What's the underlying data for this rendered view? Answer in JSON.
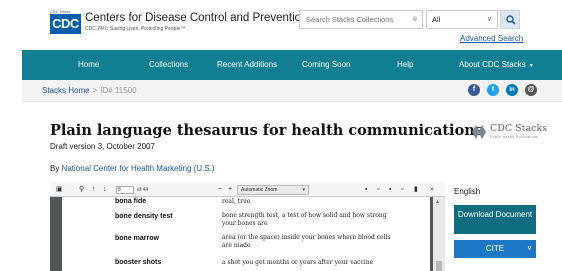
{
  "header": {
    "logo_tag": "CDC Home",
    "logo_text": "CDC",
    "org_name": "Centers for Disease Control and Prevention",
    "tagline": "CDC 24/7: Saving Lives, Protecting People™",
    "search_placeholder": "Search Stacks Collections",
    "scope_value": "All",
    "advanced_search": "Advanced Search"
  },
  "nav": {
    "items": [
      "Home",
      "Collections",
      "Recent Additions",
      "Coming Soon",
      "Help",
      "About CDC Stacks"
    ]
  },
  "breadcrumb": {
    "home": "Stacks Home",
    "separator": ">",
    "id": "ID# 11500"
  },
  "social": {
    "facebook": "f",
    "twitter": "t",
    "linkedin": "in",
    "email": "@"
  },
  "document": {
    "title": "Plain language thesaurus for health communications",
    "draft": "Draft version 3, October 2007",
    "by_prefix": "By",
    "author": "National Center for Health Marketing (U.S.)"
  },
  "stacks_logo": {
    "word": "CDC Stacks",
    "sub": "Public Health Publications"
  },
  "viewer": {
    "page_number": "8",
    "page_total": "of 44",
    "zoom": "Automatic Zoom",
    "entries": [
      {
        "term": "bona fide",
        "definition": "real, true"
      },
      {
        "term": "bone density test",
        "definition": "bone strength test, a test of how solid and how strong your bones are"
      },
      {
        "term": "bone marrow",
        "definition": "area (or the space) inside your bones where blood cells are made"
      },
      {
        "term": "booster shots",
        "definition": "a shot you get months or years after your vaccine"
      }
    ]
  },
  "sidebar": {
    "language": "English",
    "download": "Download Document",
    "cite": "CITE"
  },
  "colors": {
    "nav_bg": "#0f7f91",
    "download_bg": "#0e6e7f",
    "cite_bg": "#1c78c6",
    "link": "#1a5aa8",
    "cdc_blue": "#005eaa"
  }
}
